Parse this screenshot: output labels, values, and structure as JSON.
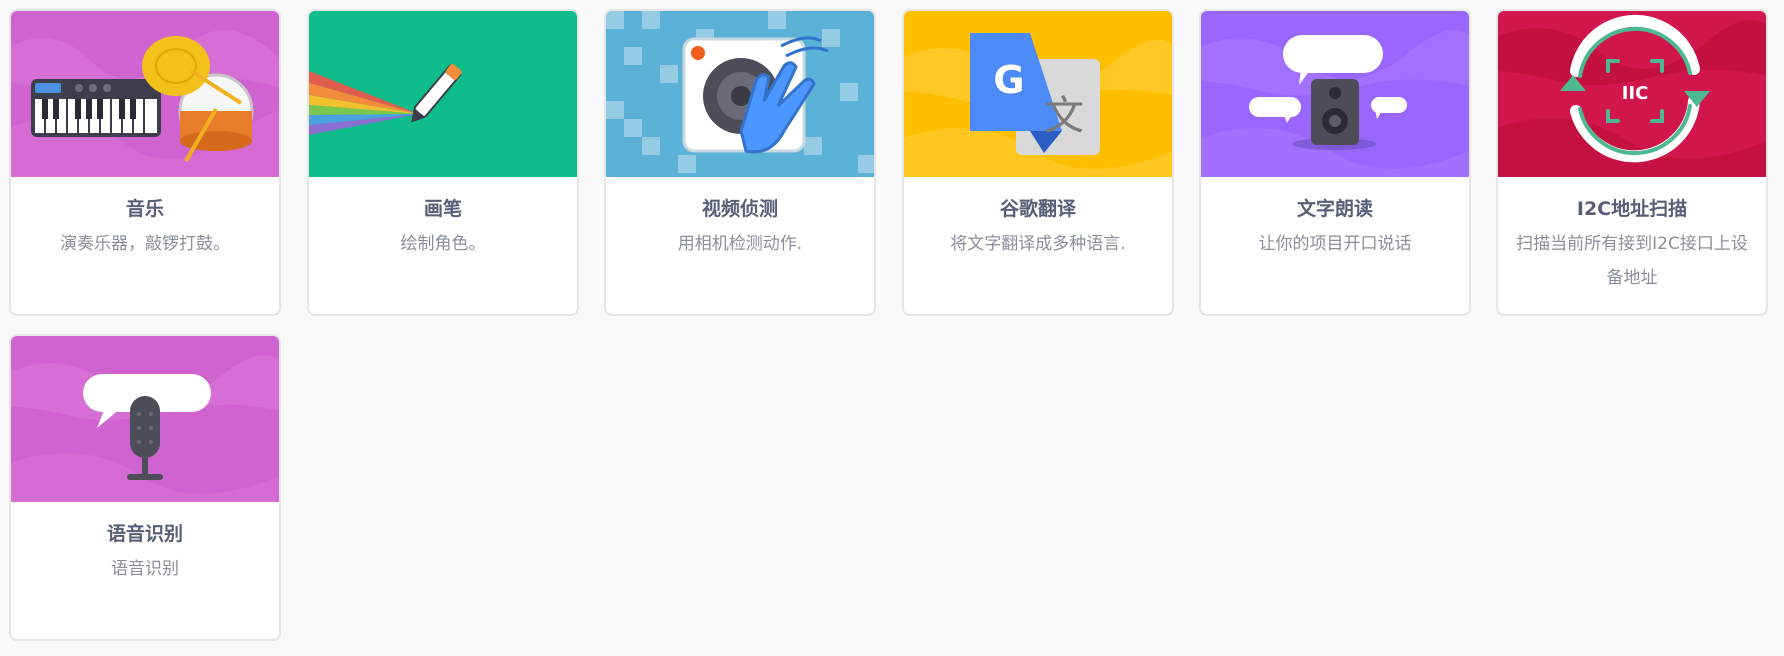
{
  "extensions": [
    {
      "key": "music",
      "title": "音乐",
      "description": "演奏乐器，敲锣打鼓。",
      "banner_color": "#cf63cf",
      "icons": [
        "piano-keyboard-icon",
        "drum-icon"
      ]
    },
    {
      "key": "pen",
      "title": "画笔",
      "description": "绘制角色。",
      "banner_color": "#0fbd8c",
      "icons": [
        "pen-icon"
      ]
    },
    {
      "key": "video",
      "title": "视频侦测",
      "description": "用相机检测动作.",
      "banner_color": "#5cb1d6",
      "icons": [
        "camera-icon",
        "waving-hand-icon"
      ]
    },
    {
      "key": "translate",
      "title": "谷歌翻译",
      "description": "将文字翻译成多种语言.",
      "banner_color": "#ffbf00",
      "icons": [
        "google-translate-icon"
      ],
      "icon_text": [
        "G",
        "文"
      ]
    },
    {
      "key": "tts",
      "title": "文字朗读",
      "description": "让你的项目开口说话",
      "banner_color": "#9966ff",
      "icons": [
        "speaker-icon",
        "speech-bubble-icon"
      ]
    },
    {
      "key": "i2c",
      "title": "I2C地址扫描",
      "description": "扫描当前所有接到I2C接口上设备地址",
      "banner_color": "#d1164d",
      "icons": [
        "scan-cycle-icon"
      ],
      "icon_text": [
        "IIC"
      ]
    },
    {
      "key": "speech",
      "title": "语音识别",
      "description": "语音识别",
      "banner_color": "#cf63cf",
      "icons": [
        "microphone-icon",
        "speech-bubble-icon"
      ]
    }
  ]
}
